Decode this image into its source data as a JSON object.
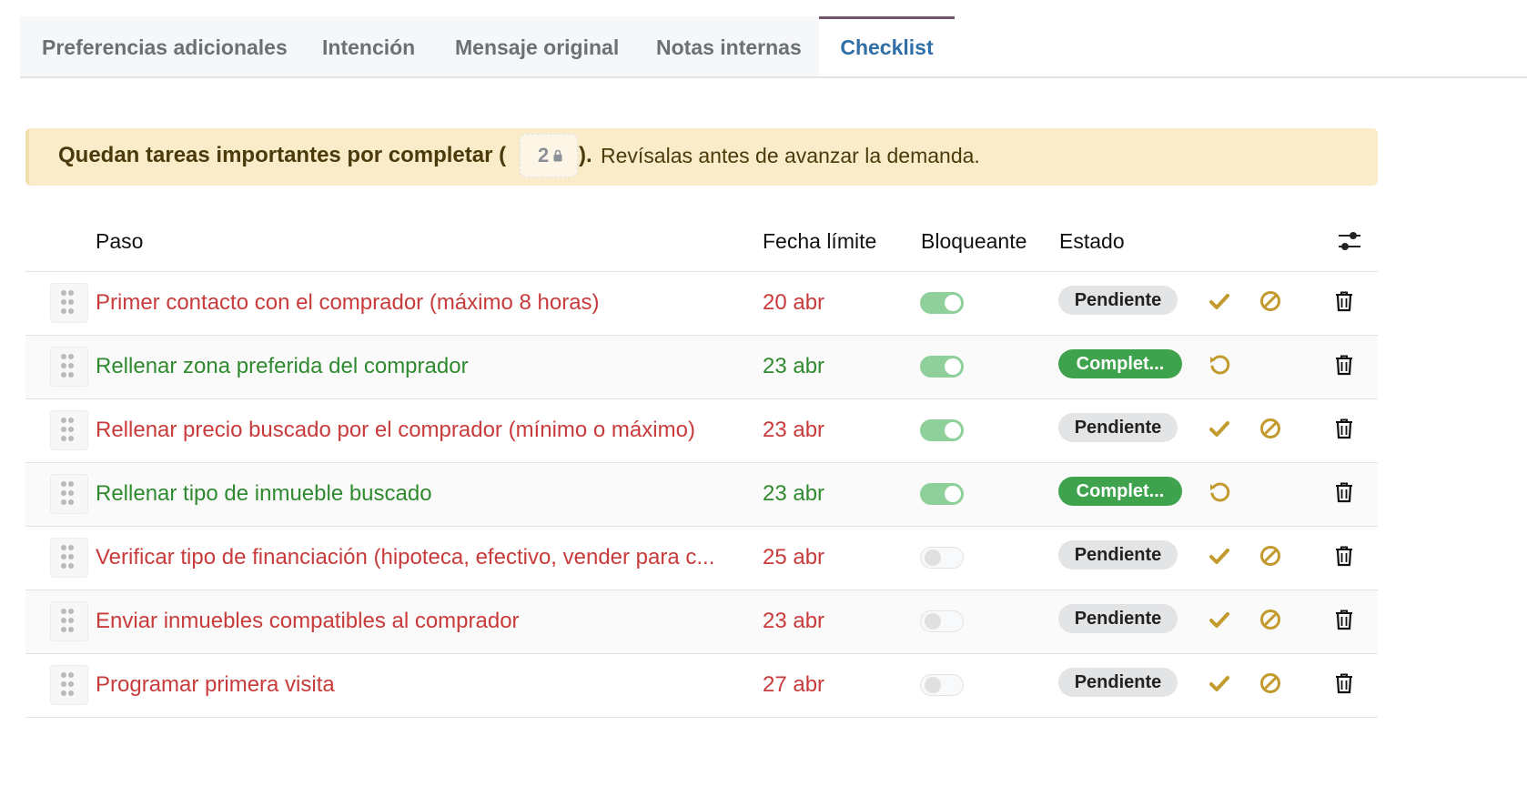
{
  "tabs": [
    {
      "label": "Preferencias adicionales",
      "active": false
    },
    {
      "label": "Intención",
      "active": false
    },
    {
      "label": "Mensaje original",
      "active": false
    },
    {
      "label": "Notas internas",
      "active": false
    },
    {
      "label": "Checklist",
      "active": true
    }
  ],
  "alert": {
    "bold_text": "Quedan tareas importantes por completar (",
    "count": "2",
    "close_paren": ").",
    "rest_text": "Revísalas antes de avanzar la demanda."
  },
  "table": {
    "headers": {
      "step": "Paso",
      "deadline": "Fecha límite",
      "blocking": "Bloqueante",
      "status": "Estado"
    },
    "rows": [
      {
        "step": "Primer contacto con el comprador (máximo 8 horas)",
        "deadline": "20 abr",
        "blocking": true,
        "status": "Pendiente",
        "state": "pending"
      },
      {
        "step": "Rellenar zona preferida del comprador",
        "deadline": "23 abr",
        "blocking": true,
        "status": "Complet...",
        "state": "done"
      },
      {
        "step": "Rellenar precio buscado por el comprador (mínimo o máximo)",
        "deadline": "23 abr",
        "blocking": true,
        "status": "Pendiente",
        "state": "pending"
      },
      {
        "step": "Rellenar tipo de inmueble buscado",
        "deadline": "23 abr",
        "blocking": true,
        "status": "Complet...",
        "state": "done"
      },
      {
        "step": "Verificar tipo de financiación (hipoteca, efectivo, vender para c...",
        "deadline": "25 abr",
        "blocking": false,
        "status": "Pendiente",
        "state": "pending"
      },
      {
        "step": "Enviar inmuebles compatibles al comprador",
        "deadline": "23 abr",
        "blocking": false,
        "status": "Pendiente",
        "state": "pending"
      },
      {
        "step": "Programar primera visita",
        "deadline": "27 abr",
        "blocking": false,
        "status": "Pendiente",
        "state": "pending"
      }
    ]
  },
  "colors": {
    "pending_text": "#c93b3b",
    "done_text": "#2f8a2f",
    "action_icon": "#c29a2e",
    "active_tab": "#2f6ea6"
  },
  "icons": {
    "row_actions_pending": [
      "check-icon",
      "ban-icon",
      "trash-icon"
    ],
    "row_actions_done": [
      "undo-icon",
      "trash-icon"
    ],
    "header": "sliders-icon",
    "row_handle": "drag-handle-icon"
  }
}
